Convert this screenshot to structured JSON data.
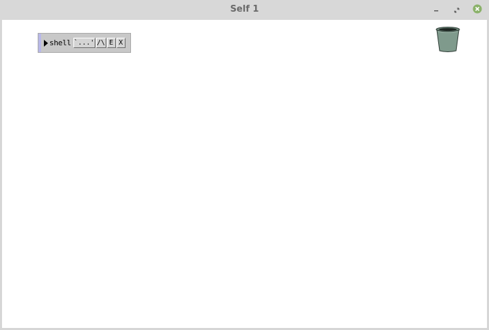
{
  "window": {
    "title": "Self 1",
    "controls": {
      "minimize_icon": "minimize-icon",
      "maximize_icon": "restore-icon",
      "close_icon": "close-icon"
    }
  },
  "shell": {
    "label": "shell",
    "buttons": {
      "evaluate": "`...'",
      "parent": "/\\",
      "edit": "E",
      "dismiss": "X"
    }
  },
  "desktop": {
    "trash_icon": "trash-can-icon"
  },
  "colors": {
    "desktop_bg": "#ffffff",
    "titlebar_bg": "#d8d8d8",
    "close_green": "#8bb26a",
    "trash_fill": "#7f9a8c"
  }
}
